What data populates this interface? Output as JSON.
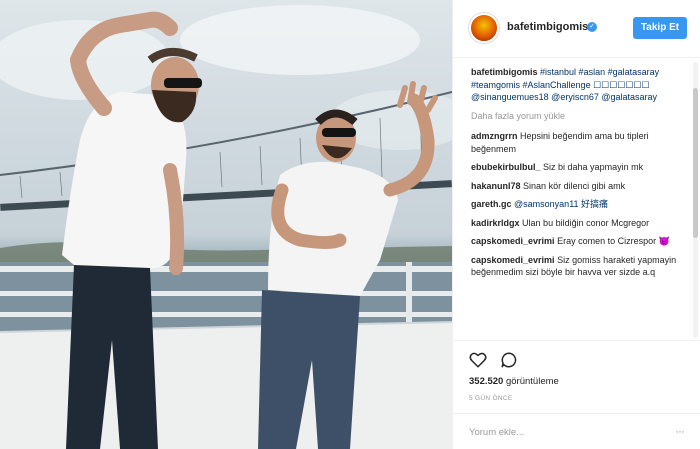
{
  "post": {
    "username": "bafetimbigomis",
    "follow_label": "Takip Et",
    "caption_user": "bafetimbigomis",
    "caption_text": "#istanbul #aslan #galatasaray #teamgomis #AslanChallenge ☐☐☐☐☐☐☐ @sinanguemues18 @eryiscn67 @galatasaray",
    "load_more": "Daha fazla yorum yükle",
    "comments": [
      {
        "user": "admzngrrn",
        "text": "Hepsini beğendim ama bu tipleri beğenmem"
      },
      {
        "user": "ebubekirbulbul_",
        "text": "Siz bi daha yapmayin mk"
      },
      {
        "user": "hakanunl78",
        "text": "Sinan kör dilenci gibi amk"
      },
      {
        "user": "gareth.gc",
        "text": "@samsonyan11 好搞痛"
      },
      {
        "user": "kadirkrldgx",
        "text": "Ulan bu bildiğin conor Mcgregor"
      },
      {
        "user": "capskomedi_evrimi",
        "text": "Eray comen to Cizrespor 😈"
      },
      {
        "user": "capskomedi_evrimi",
        "text": "Siz gomiss haraketi yapmayin beğenmedim sizi böyle bir havva ver sizde a.q"
      }
    ],
    "views": "352.520",
    "views_label": "görüntüleme",
    "time_ago": "5 GÜN ÖNCE",
    "comment_placeholder": "Yorum ekle...",
    "more_options": "···"
  },
  "icons": {
    "verified": "verified-badge-icon",
    "like": "heart-icon",
    "comment": "comment-bubble-icon",
    "more": "more-options-icon"
  },
  "colors": {
    "accent": "#3897f0",
    "link": "#003569",
    "muted": "#999999"
  }
}
